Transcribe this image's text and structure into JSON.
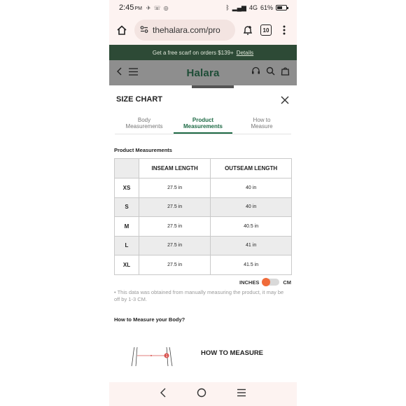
{
  "status_bar": {
    "time": "2:45",
    "ampm": "PM",
    "battery_percent": "61%",
    "battery_level": 0.61,
    "network": "4G"
  },
  "browser": {
    "url": "thehalara.com/pro",
    "tab_count": "10"
  },
  "promo": {
    "text": "Get a free scarf on orders $139+",
    "link": "Details"
  },
  "site": {
    "logo": "Halara"
  },
  "modal": {
    "title": "SIZE CHART",
    "tabs": [
      {
        "line1": "Body",
        "line2": "Measurements",
        "active": false
      },
      {
        "line1": "Product",
        "line2": "Measurements",
        "active": true
      },
      {
        "line1": "How to",
        "line2": "Measure",
        "active": false
      }
    ],
    "section_label": "Product Measurements",
    "table": {
      "headers": [
        "INSEAM LENGTH",
        "OUTSEAM LENGTH"
      ],
      "rows": [
        {
          "size": "XS",
          "inseam": "27.5 in",
          "outseam": "40 in"
        },
        {
          "size": "S",
          "inseam": "27.5 in",
          "outseam": "40 in"
        },
        {
          "size": "M",
          "inseam": "27.5 in",
          "outseam": "40.5 in"
        },
        {
          "size": "L",
          "inseam": "27.5 in",
          "outseam": "41 in"
        },
        {
          "size": "XL",
          "inseam": "27.5 in",
          "outseam": "41.5 in"
        }
      ]
    },
    "units": {
      "left": "INCHES",
      "right": "CM",
      "selected": "INCHES"
    },
    "note": "This data was obtained from manually measuring the product, it may be off by 1-3 CM.",
    "howto_title": "How to Measure your Body?",
    "howto_label": "HOW TO MEASURE"
  },
  "colors": {
    "brand_green": "#1e6a45",
    "promo_bg": "#2d4a36",
    "toggle_accent": "#f06b3a"
  }
}
